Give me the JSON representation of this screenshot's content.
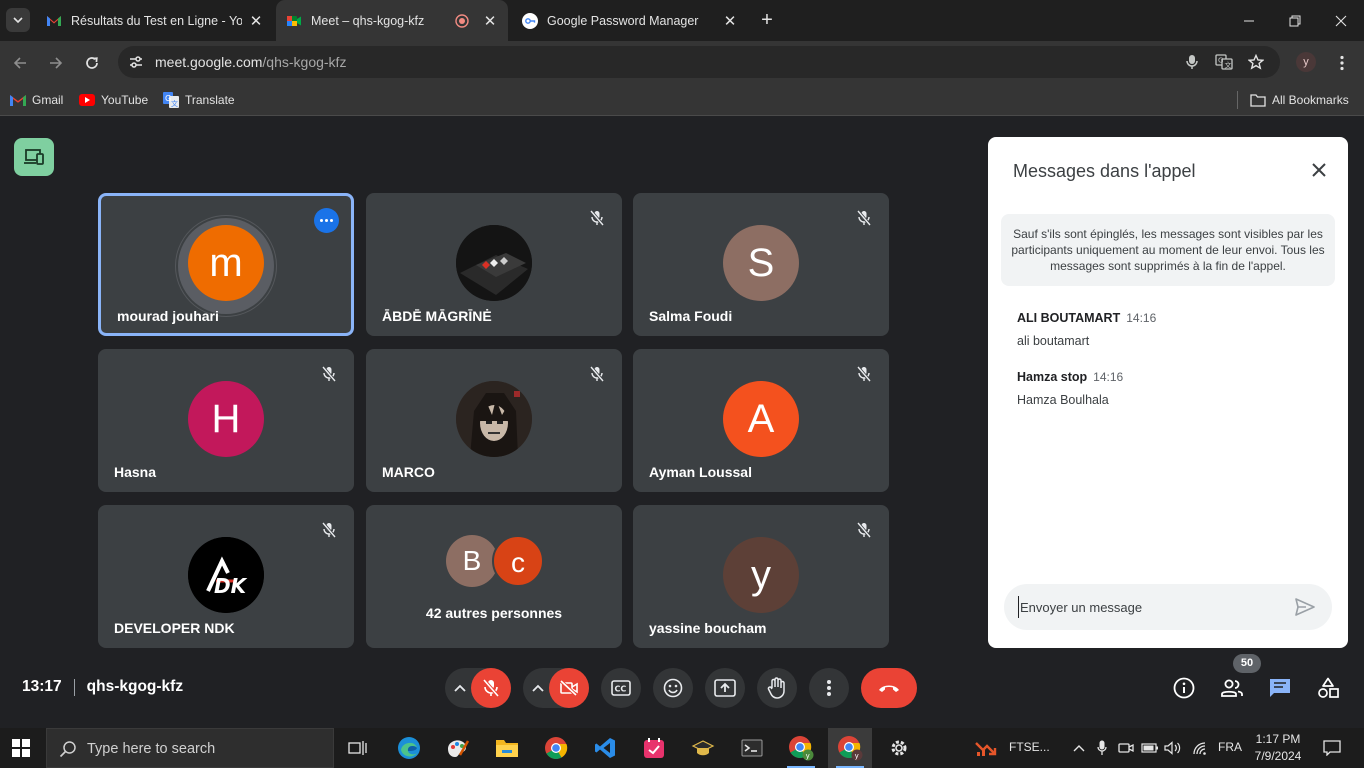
{
  "browser": {
    "tabs": [
      {
        "title": "Résultats du Test en Ligne - You",
        "favicon": "gmail-icon"
      },
      {
        "title": "Meet – qhs-kgog-kfz",
        "favicon": "meet-icon",
        "recording": true
      },
      {
        "title": "Google Password Manager",
        "favicon": "password-manager-icon"
      }
    ],
    "url_host": "meet.google.com",
    "url_path": "/qhs-kgog-kfz",
    "profile_initial": "y",
    "bookmarks": [
      {
        "label": "Gmail",
        "icon": "gmail-icon"
      },
      {
        "label": "YouTube",
        "icon": "youtube-icon"
      },
      {
        "label": "Translate",
        "icon": "translate-icon"
      }
    ],
    "all_bookmarks": "All Bookmarks"
  },
  "meet": {
    "participants": [
      {
        "name": "mourad jouhari",
        "initial": "m",
        "color": "#ef6c00",
        "speaking": true
      },
      {
        "name": "ĀBDĒ MĀGRĪNĖ",
        "initial": "",
        "color": "#1b1b1b",
        "photo": true,
        "muted": true
      },
      {
        "name": "Salma Foudi",
        "initial": "S",
        "color": "#8d6e63",
        "muted": true
      },
      {
        "name": "Hasna",
        "initial": "H",
        "color": "#c2185b",
        "muted": true
      },
      {
        "name": "MARCO",
        "initial": "",
        "color": "#3a2f2a",
        "photo": true,
        "muted": true
      },
      {
        "name": "Ayman Loussal",
        "initial": "A",
        "color": "#f4511e",
        "muted": true
      },
      {
        "name": "DEVELOPER NDK",
        "initial": "",
        "color": "#000000",
        "photo": true,
        "muted": true
      },
      {
        "name": "yassine boucham",
        "initial": "y",
        "color": "#5d4037",
        "muted": true
      }
    ],
    "others": {
      "label": "42 autres personnes",
      "avatars": [
        {
          "initial": "B",
          "color": "#8d6e63"
        },
        {
          "initial": "c",
          "color": "#d84315"
        }
      ]
    },
    "clock": "13:17",
    "meeting_code": "qhs-kgog-kfz",
    "participant_count": "50"
  },
  "chat": {
    "title": "Messages dans l'appel",
    "notice": "Sauf s'ils sont épinglés, les messages sont visibles par les participants uniquement au moment de leur envoi. Tous les messages sont supprimés à la fin de l'appel.",
    "messages": [
      {
        "author": "ALI BOUTAMART",
        "time": "14:16",
        "text": "ali boutamart"
      },
      {
        "author": "Hamza stop",
        "time": "14:16",
        "text": "Hamza Boulhala"
      }
    ],
    "input_placeholder": "Envoyer un message"
  },
  "taskbar": {
    "search_placeholder": "Type here to search",
    "ftse_label": "FTSE...",
    "language": "FRA",
    "time": "1:17 PM",
    "date": "7/9/2024"
  }
}
